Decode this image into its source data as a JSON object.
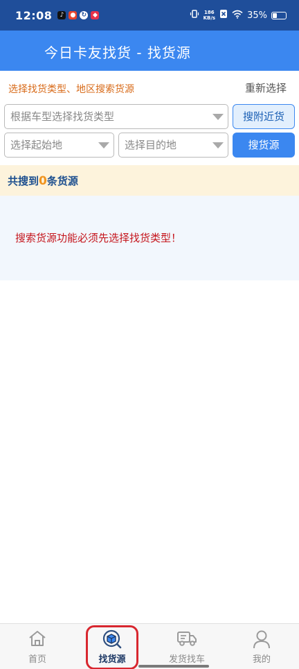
{
  "status_bar": {
    "time": "12:08",
    "net_speed_value": "186",
    "net_speed_unit": "KB/s",
    "battery_text": "35%",
    "battery_level": 0.35
  },
  "header": {
    "title": "今日卡友找货 - 找货源"
  },
  "filters": {
    "hint": "选择找货类型、地区搜索货源",
    "reset_label": "重新选择",
    "type_select": "根据车型选择找货类型",
    "origin_select": "选择起始地",
    "dest_select": "选择目的地",
    "nearby_button": "搜附近货",
    "search_button": "搜货源"
  },
  "results": {
    "count_prefix": "共搜到",
    "count": "0",
    "count_suffix": "条货源",
    "message": "搜索货源功能必须先选择找货类型！"
  },
  "tabbar": {
    "tabs": [
      {
        "label": "首页",
        "icon": "home-icon"
      },
      {
        "label": "找货源",
        "icon": "cargo-search-icon"
      },
      {
        "label": "发货找车",
        "icon": "truck-icon"
      },
      {
        "label": "我的",
        "icon": "user-icon"
      }
    ],
    "active_index": 1
  },
  "colors": {
    "status_bar": "#1f4e9a",
    "title_bar": "#3b87f0",
    "accent": "#3b87f0",
    "hint_orange": "#d86b1a",
    "error_red": "#c5161d",
    "highlight_red": "#d8272f"
  }
}
